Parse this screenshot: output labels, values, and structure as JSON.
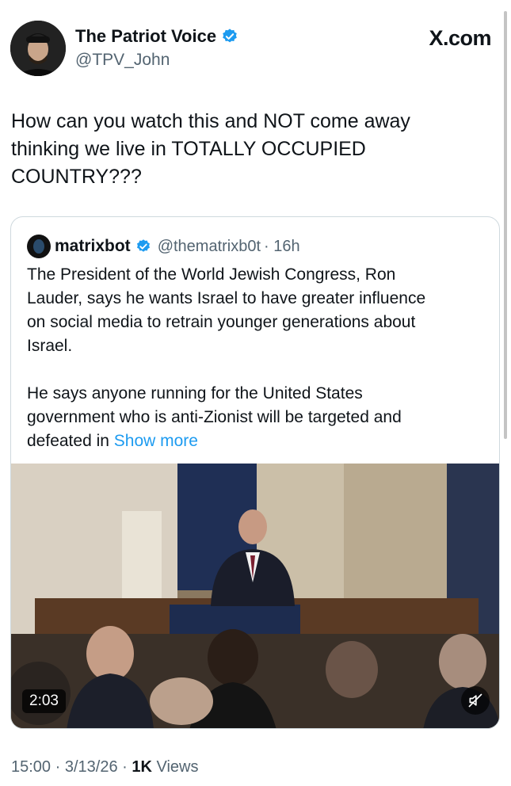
{
  "author": {
    "name": "The Patriot Voice",
    "handle": "@TPV_John",
    "verified": true
  },
  "brand": "X.com",
  "tweet_text": "How can you watch this and NOT come away\nthinking we live in TOTALLY OCCUPIED\nCOUNTRY???",
  "quote": {
    "name": "matrixbot",
    "handle": "@thematrixb0t",
    "time": "· 16h",
    "text": "The President of the World Jewish Congress, Ron\nLauder, says he wants Israel to have greater influence\non social media to retrain younger generations about\nIsrael.\n\nHe says anyone running for the United States\ngovernment who is anti-Zionist will be targeted and\ndefeated in ",
    "show_more": "Show more"
  },
  "video": {
    "duration": "2:03",
    "mute_icon": "muted-speaker-icon"
  },
  "footer": {
    "time": "15:00",
    "date": "· 3/13/26 ·",
    "views_count": "1K",
    "views_label": "Views"
  },
  "colors": {
    "link": "#1d9bf0",
    "verified": "#1d9bf0",
    "secondary_text": "#536471"
  }
}
